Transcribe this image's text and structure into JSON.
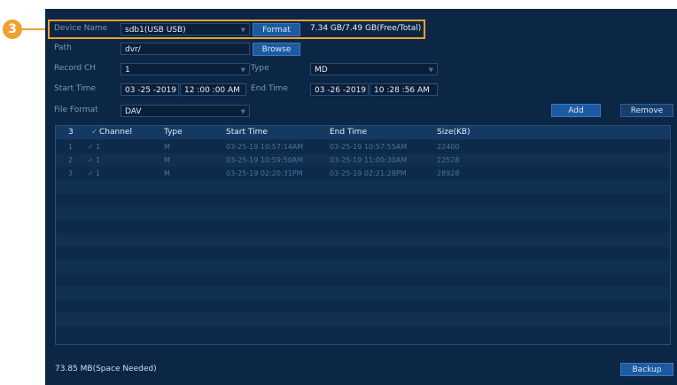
{
  "callout": {
    "number": "3"
  },
  "device": {
    "label": "Device Name",
    "value": "sdb1(USB USB)",
    "format_button": "Format",
    "capacity": "7.34 GB/7.49 GB(Free/Total)"
  },
  "path": {
    "label": "Path",
    "value": "dvr/",
    "browse_button": "Browse"
  },
  "record_ch": {
    "label": "Record CH",
    "value": "1"
  },
  "type": {
    "label": "Type",
    "value": "MD"
  },
  "start_time": {
    "label": "Start Time",
    "date": "03 -25 -2019",
    "time": "12 :00 :00 AM"
  },
  "end_time": {
    "label": "End Time",
    "date": "03 -26 -2019",
    "time": "10 :28 :56 AM"
  },
  "file_format": {
    "label": "File Format",
    "value": "DAV"
  },
  "buttons": {
    "add": "Add",
    "remove": "Remove",
    "backup": "Backup"
  },
  "table": {
    "headers": {
      "index": "3",
      "channel": "Channel",
      "type": "Type",
      "start": "Start Time",
      "end": "End Time",
      "size": "Size(KB)"
    },
    "rows": [
      {
        "index": "1",
        "channel": "1",
        "type": "M",
        "start": "03-25-19 10:57:14AM",
        "end": "03-25-19 10:57:55AM",
        "size": "22400"
      },
      {
        "index": "2",
        "channel": "1",
        "type": "M",
        "start": "03-25-19 10:59:50AM",
        "end": "03-25-19 11:00:30AM",
        "size": "22528"
      },
      {
        "index": "3",
        "channel": "1",
        "type": "M",
        "start": "03-25-19 02:20:31PM",
        "end": "03-25-19 02:21:28PM",
        "size": "28928"
      }
    ]
  },
  "space_needed": "73.85 MB(Space Needed)"
}
